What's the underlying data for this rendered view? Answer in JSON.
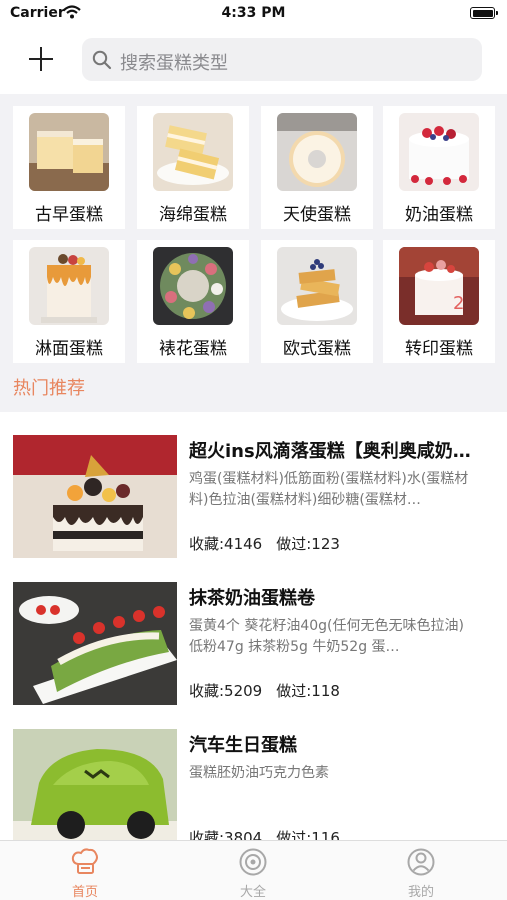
{
  "status_bar": {
    "carrier": "Carrier",
    "time": "4:33 PM"
  },
  "header": {
    "search_placeholder": "搜索蛋糕类型"
  },
  "categories": [
    {
      "label": "古早蛋糕"
    },
    {
      "label": "海绵蛋糕"
    },
    {
      "label": "天使蛋糕"
    },
    {
      "label": "奶油蛋糕"
    },
    {
      "label": "淋面蛋糕"
    },
    {
      "label": "裱花蛋糕"
    },
    {
      "label": "欧式蛋糕"
    },
    {
      "label": "转印蛋糕"
    }
  ],
  "hot_section": {
    "title": "热门推荐"
  },
  "recipes": [
    {
      "title": "超火ins风滴落蛋糕【奥利奥咸奶…",
      "description": "鸡蛋(蛋糕材料)低筋面粉(蛋糕材料)水(蛋糕材料)色拉油(蛋糕材料)细砂糖(蛋糕材…",
      "favorites": "收藏:4146",
      "made": "做过:123"
    },
    {
      "title": "抹茶奶油蛋糕卷",
      "description": "蛋黄4个 葵花籽油40g(任何无色无味色拉油) 低粉47g 抹茶粉5g   牛奶52g    蛋…",
      "favorites": "收藏:5209",
      "made": "做过:118"
    },
    {
      "title": "汽车生日蛋糕",
      "description": "蛋糕胚奶油巧克力色素",
      "favorites": "收藏:3804",
      "made": "做过:116"
    }
  ],
  "tab_bar": {
    "tabs": [
      {
        "label": "首页",
        "icon": "chef-hat-icon"
      },
      {
        "label": "大全",
        "icon": "compass-icon"
      },
      {
        "label": "我的",
        "icon": "user-icon"
      }
    ],
    "active_color": "#e8865f",
    "inactive_color": "#a8a8a8"
  }
}
